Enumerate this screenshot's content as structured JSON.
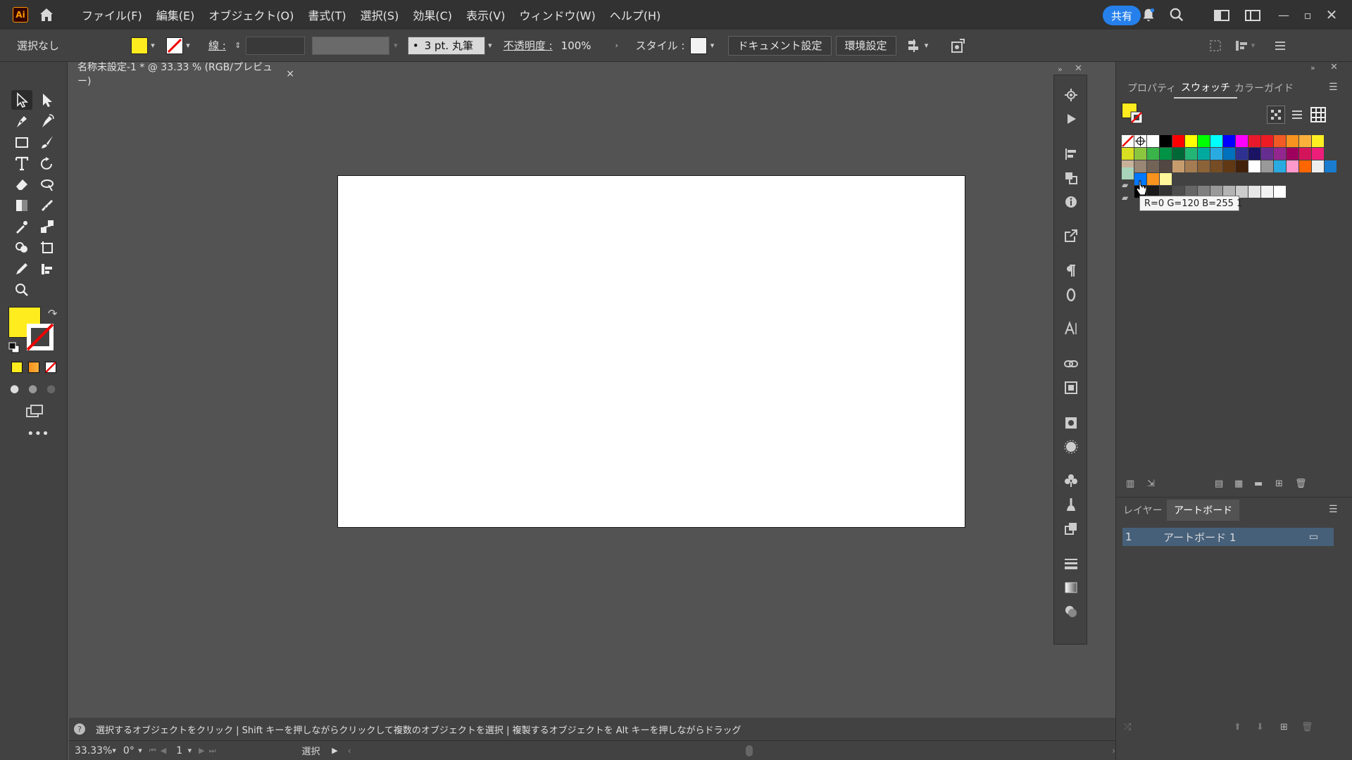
{
  "app": {
    "logo": "Ai"
  },
  "menu": [
    "ファイル(F)",
    "編集(E)",
    "オブジェクト(O)",
    "書式(T)",
    "選択(S)",
    "効果(C)",
    "表示(V)",
    "ウィンドウ(W)",
    "ヘルプ(H)"
  ],
  "header": {
    "share_label": "共有"
  },
  "control": {
    "selection_label": "選択なし",
    "stroke_label": "線 :",
    "brush_label": "3 pt. 丸筆",
    "opacity_label": "不透明度 :",
    "opacity_value": "100%",
    "style_label": "スタイル :",
    "doc_settings_label": "ドキュメント設定",
    "prefs_label": "環境設定",
    "fill_color": "#ffec1f"
  },
  "document": {
    "tab_title": "名称未設定-1 * @ 33.33 % (RGB/プレビュー)",
    "close": "×"
  },
  "panel": {
    "tabs": [
      "プロパティ",
      "スウォッチ",
      "カラーガイド"
    ],
    "active_tab": 1,
    "tooltip": "R=0 G=120 B=255 1",
    "layer_tabs": [
      "レイヤー",
      "アートボード"
    ],
    "artboard_row": {
      "index": "1",
      "name": "アートボード 1"
    }
  },
  "swatches": {
    "row1": [
      "#ffffff",
      "#000000",
      "#ff0000",
      "#ffff00",
      "#00ff00",
      "#00ffff",
      "#0000ff",
      "#ff00ff",
      "#e8192c",
      "#ed1c24",
      "#f15a24",
      "#f7931e",
      "#fbb03b",
      "#fcee21"
    ],
    "row2": [
      "#d9e021",
      "#8cc63f",
      "#39b54a",
      "#009245",
      "#006837",
      "#22b573",
      "#00a99d",
      "#29abe2",
      "#0071bc",
      "#2e3192",
      "#1b1464",
      "#662d91",
      "#93278f",
      "#9e005d",
      "#d4145a",
      "#ed1e79"
    ],
    "row3": [
      "#c7b299",
      "#998675",
      "#736357",
      "#534741",
      "#c69c6d",
      "#a67c52",
      "#8c6239",
      "#754c24",
      "#603813",
      "#42210b",
      "#ffffff",
      "#999999",
      "#29abe2",
      "#ff99cc",
      "#ff6600",
      "#eeeeee",
      "#1a7ccf"
    ],
    "row4": [
      "#a8d5ba",
      "#0078ff",
      "#f7931e",
      "#fff799"
    ],
    "grays": [
      "#000000",
      "#1a1a1a",
      "#333333",
      "#4d4d4d",
      "#666666",
      "#808080",
      "#999999",
      "#b3b3b3",
      "#cccccc",
      "#e6e6e6",
      "#f2f2f2",
      "#ffffff"
    ]
  },
  "status": {
    "hint": "選択するオブジェクトをクリック | Shift キーを押しながらクリックして複数のオブジェクトを選択 | 複製するオブジェクトを Alt キーを押しながらドラッグ",
    "zoom": "33.33%",
    "rotation": "0°",
    "artboard_num": "1",
    "tool_name": "選択"
  }
}
